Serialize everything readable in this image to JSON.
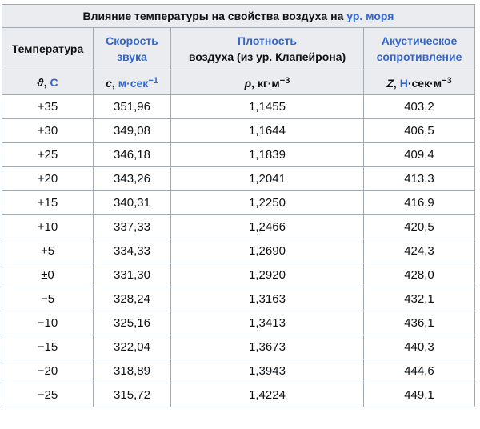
{
  "caption": {
    "text": "Влияние температуры на свойства воздуха на ",
    "link": "ур. моря"
  },
  "headers": {
    "temperature": "Температура",
    "speed_line1": "Скорость",
    "speed_line2": "звука",
    "density_line1": "Плотность",
    "density_line2": "воздуха (из ур. Клапейрона)",
    "impedance_line1": "Акустическое",
    "impedance_line2": "сопротивление"
  },
  "units": {
    "temp_symbol": "ϑ",
    "temp_sep": ", ",
    "temp_unit": "C",
    "speed_symbol": "c",
    "speed_sep": ", ",
    "speed_unit": "м·сек",
    "speed_exp": "−1",
    "density_symbol": "ρ",
    "density_unit": ", кг·м",
    "density_exp": "−3",
    "imp_symbol": "Z",
    "imp_sep": ", ",
    "imp_unit_link": "Н",
    "imp_unit_rest": "·сек·м",
    "imp_exp": "−3"
  },
  "rows": [
    {
      "t": "+35",
      "c": "351,96",
      "rho": "1,1455",
      "z": "403,2"
    },
    {
      "t": "+30",
      "c": "349,08",
      "rho": "1,1644",
      "z": "406,5"
    },
    {
      "t": "+25",
      "c": "346,18",
      "rho": "1,1839",
      "z": "409,4"
    },
    {
      "t": "+20",
      "c": "343,26",
      "rho": "1,2041",
      "z": "413,3"
    },
    {
      "t": "+15",
      "c": "340,31",
      "rho": "1,2250",
      "z": "416,9"
    },
    {
      "t": "+10",
      "c": "337,33",
      "rho": "1,2466",
      "z": "420,5"
    },
    {
      "t": "+5",
      "c": "334,33",
      "rho": "1,2690",
      "z": "424,3"
    },
    {
      "t": "±0",
      "c": "331,30",
      "rho": "1,2920",
      "z": "428,0"
    },
    {
      "t": "−5",
      "c": "328,24",
      "rho": "1,3163",
      "z": "432,1"
    },
    {
      "t": "−10",
      "c": "325,16",
      "rho": "1,3413",
      "z": "436,1"
    },
    {
      "t": "−15",
      "c": "322,04",
      "rho": "1,3673",
      "z": "440,3"
    },
    {
      "t": "−20",
      "c": "318,89",
      "rho": "1,3943",
      "z": "444,6"
    },
    {
      "t": "−25",
      "c": "315,72",
      "rho": "1,4224",
      "z": "449,1"
    }
  ]
}
